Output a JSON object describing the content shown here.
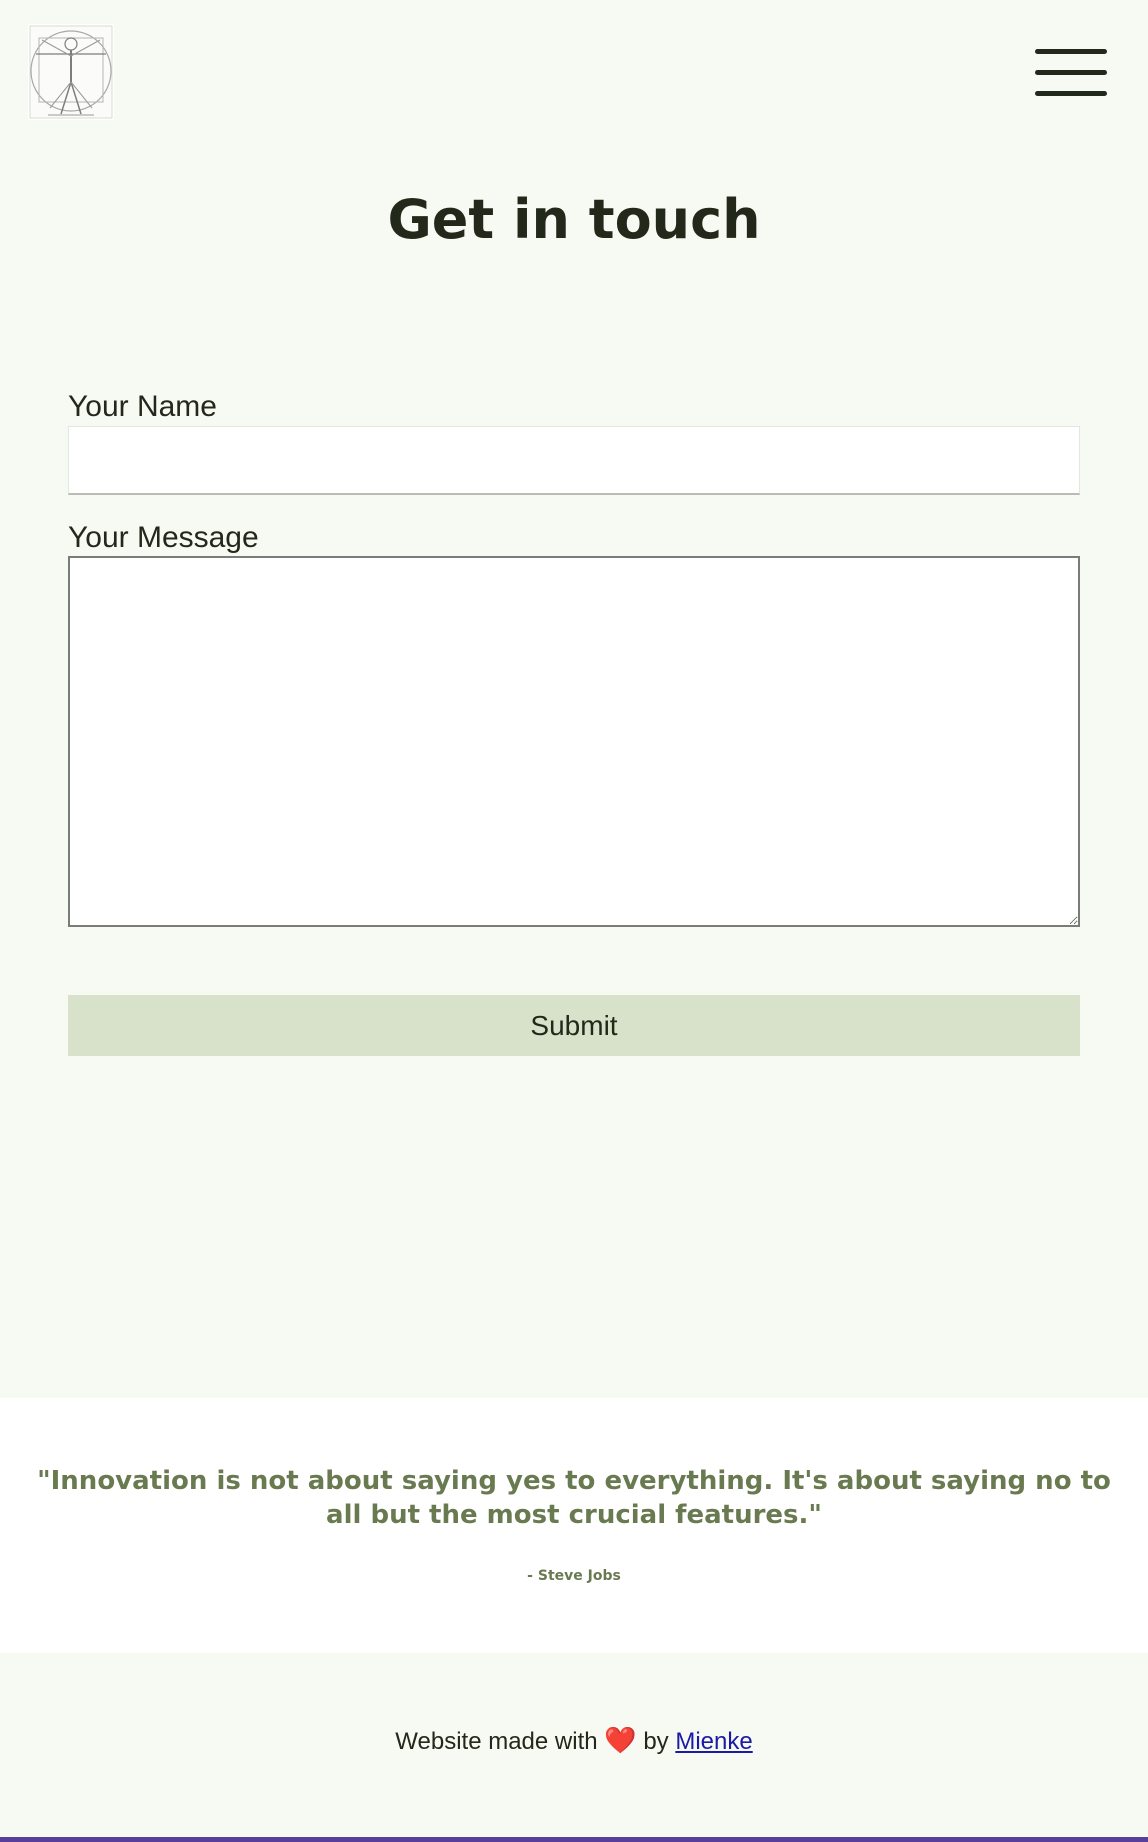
{
  "header": {
    "logo_icon": "vitruvian-man-logo-icon",
    "menu_icon": "hamburger-menu-icon"
  },
  "page": {
    "title": "Get in touch"
  },
  "form": {
    "name_label": "Your Name",
    "name_value": "",
    "message_label": "Your Message",
    "message_value": "",
    "submit_label": "Submit"
  },
  "quote": {
    "text": "\"Innovation is not about saying yes to everything. It's about saying no to all but the most crucial features.\"",
    "author": "- Steve Jobs"
  },
  "footer": {
    "prefix": "Website made with",
    "heart_icon": "heart-icon",
    "heart_glyph": "❤️",
    "by": "by",
    "author_link": "Mienke"
  },
  "colors": {
    "background": "#f7f9f3",
    "text": "#23291a",
    "button": "#d8e2cb",
    "quote": "#6a7a50",
    "link": "#1a1aa6"
  }
}
